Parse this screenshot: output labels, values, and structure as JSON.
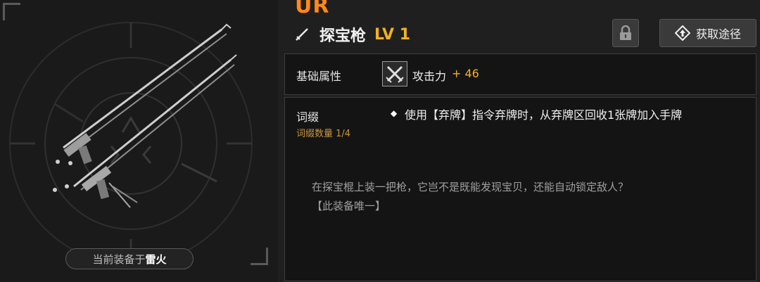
{
  "item": {
    "rarity": "UR",
    "name": "探宝枪",
    "level": "LV 1",
    "equipped_prefix": "当前装备于",
    "equipped_owner": "雷火"
  },
  "buttons": {
    "lock_icon": "lock-icon",
    "acquire_label": "获取途径"
  },
  "base_attributes": {
    "label": "基础属性",
    "stat_label": "攻击力",
    "stat_value": "+ 46"
  },
  "affix": {
    "label": "词缀",
    "count_label": "词缀数量 1/4",
    "effect": "使用【弃牌】指令弃牌时，从弃牌区回收1张牌加入手牌"
  },
  "flavor_text": {
    "line1": "在探宝棍上装一把枪，它岂不是既能发现宝贝，还能自动锁定敌人？",
    "line2": "【此装备唯一】"
  },
  "colors": {
    "accent_orange": "#ff8a1a",
    "accent_gold": "#f3b21e",
    "panel_bg": "#141414",
    "border": "#3d3d3d"
  }
}
